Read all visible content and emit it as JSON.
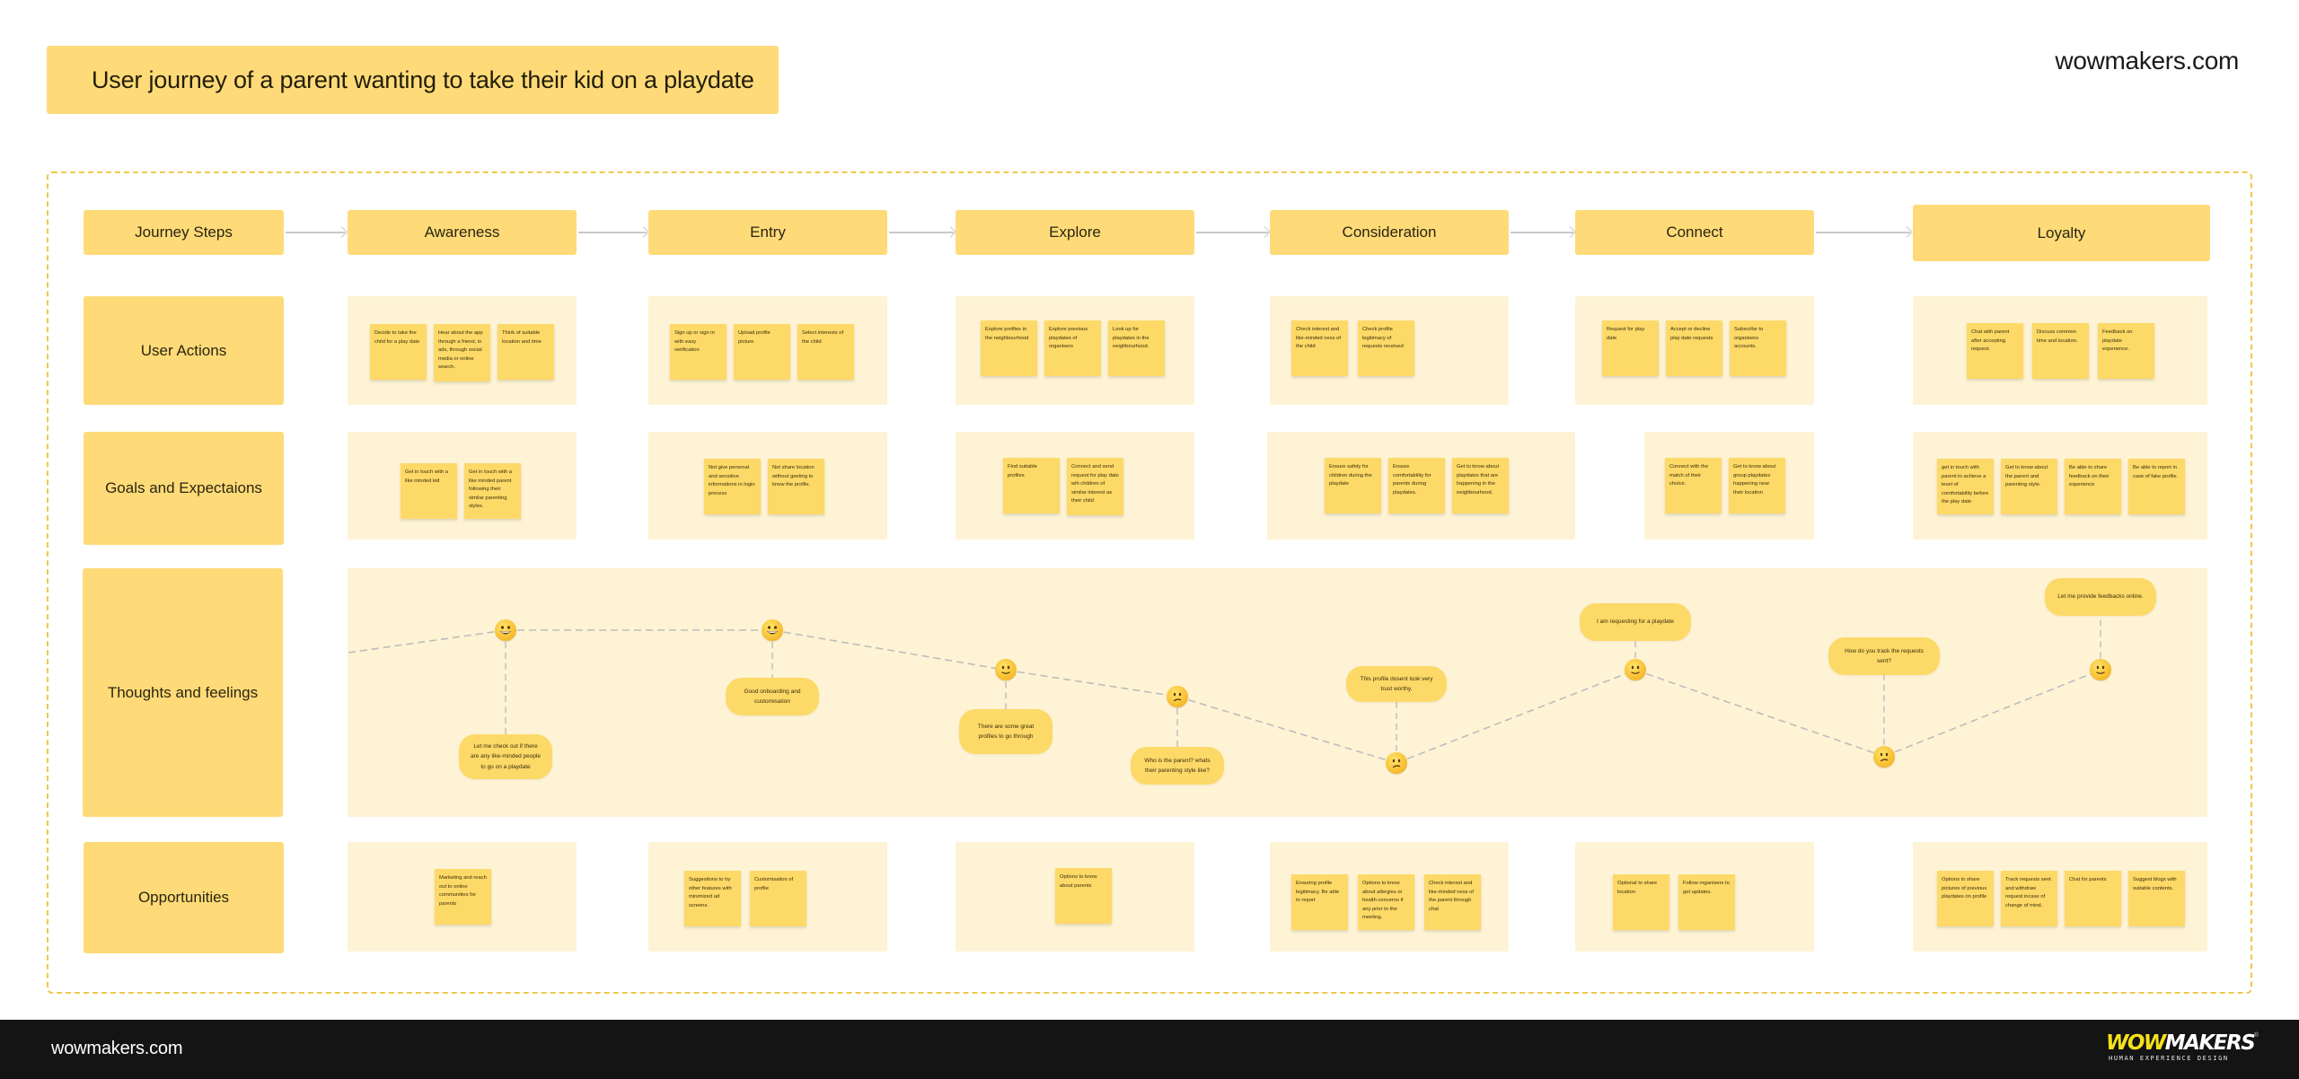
{
  "header": {
    "title": "User journey of a parent wanting to take their kid on a playdate",
    "brand": "wowmakers.com"
  },
  "colors": {
    "label_fill": "#fedb78",
    "panel_fill": "#fef3d4",
    "note_fill": "#fdd968",
    "frame_border": "#f0c84a",
    "footer_bg": "#141414",
    "logo_accent": "#f5e21b"
  },
  "rows": {
    "journey_steps": "Journey Steps",
    "user_actions": "User Actions",
    "goals": "Goals and Expectaions",
    "thoughts": "Thoughts and feelings",
    "opportunities": "Opportunities"
  },
  "stages": [
    {
      "name": "Awareness",
      "actions": [
        "Decide to take the child for a play date",
        "Hear about the app  through a friend, in ads, through social media or online search.",
        "Think of suitable location and time"
      ],
      "goals": [
        "Get in touch with a like minded kid",
        "Get in touch with a like minded parent following their similar parenting styles."
      ],
      "opportunities": [
        "Marketing and reach out to online communities for parents"
      ]
    },
    {
      "name": "Entry",
      "actions": [
        "Sign up or sign in with easy verification",
        "Upload profile picture",
        "Select interests of the child"
      ],
      "goals": [
        "Not give personal and sensitive informations in login process",
        "Not share location without geeting to know the profile."
      ],
      "opportunities": [
        "Suggestions to try other features with minimized ad screens.",
        "Customisation of profile"
      ]
    },
    {
      "name": "Explore",
      "actions": [
        "Explore profiles in the neighbourhood",
        "Explore previous playdates of organisers",
        "Look up for playdates in the neighbourhood."
      ],
      "goals": [
        "Find suitable profiles",
        "Connect and send request for play date wih children of similar interest as their child"
      ],
      "opportunities": [
        "Options to know about parents"
      ]
    },
    {
      "name": "Consideration",
      "actions": [
        "Check interest and like-minded ness of the child",
        "Check profile legitimacy of requests received"
      ],
      "goals": [
        "Ensure safety for children during the playdate",
        "Ensure comfortability for parents during playdates.",
        "Get to know about playdates that are happening in the neighbourhood."
      ],
      "opportunities": [
        "Ensuring profile legitimacy. Be able to report",
        "Options to know about allergies or health concerns if any prior to the meeting.",
        "Check interest and like-minded ness of the parent through chat"
      ]
    },
    {
      "name": "Connect",
      "actions": [
        "Request for play date",
        "Accept or decline play date requests",
        "Subscribe to organisers accounts."
      ],
      "goals": [
        "Connect with the match of their choice.",
        "Get to know about group playdates happening near their location"
      ],
      "opportunities": [
        "Optional to share location",
        "Follow organisers to get updates."
      ]
    },
    {
      "name": "Loyalty",
      "actions": [
        "Chat with parent after accepting request.",
        "Discuss common time and location.",
        "Feedback on playdate experience."
      ],
      "goals": [
        "get in touch with parent to achieve a level of comfortability before the play date",
        "Get to know about the parent and parenting style.",
        "Be able to share feedback on their experience",
        "Be able to report in case of fake profile."
      ],
      "opportunities": [
        "Options to share pictures of previous playdates on profile",
        "Track requests sent and withdraw request incase of change of mind.",
        "Chat for parents",
        "Suggest blogs with suitable contents."
      ]
    }
  ],
  "emotion_curve": {
    "scale": "1 = unhappy, 3 = very happy",
    "points": [
      {
        "stage": "Awareness",
        "mood": "grinning",
        "level": 3,
        "thought": "Let me check out if there are any like-minded people to go on a playdate",
        "bubble_position": "below"
      },
      {
        "stage": "Entry",
        "mood": "grinning",
        "level": 3,
        "thought": "Good onboarding and customisation",
        "bubble_position": "below"
      },
      {
        "stage": "Explore",
        "mood": "slight-smile",
        "level": 2.4,
        "thought": "There are some great profiles to go through",
        "bubble_position": "below"
      },
      {
        "stage": "Explore",
        "mood": "confused",
        "level": 2.0,
        "thought": "Who is the parent? whats their parenting style like?",
        "bubble_position": "below"
      },
      {
        "stage": "Consideration",
        "mood": "confused",
        "level": 1.0,
        "thought": "This profile dosent look very trust worthy.",
        "bubble_position": "above"
      },
      {
        "stage": "Connect",
        "mood": "slight-smile",
        "level": 2.4,
        "thought": "I am requesting for a playdate",
        "bubble_position": "above"
      },
      {
        "stage": "Connect",
        "mood": "confused",
        "level": 1.1,
        "thought": "How do you track the requests sent?",
        "bubble_position": "above"
      },
      {
        "stage": "Loyalty",
        "mood": "slight-smile",
        "level": 2.4,
        "thought": "Let me provide feedbacks online.",
        "bubble_position": "above"
      }
    ]
  },
  "footer": {
    "url": "wowmakers.com",
    "logo_wow": "WOW",
    "logo_makers": "MAKERS",
    "logo_tagline": "HUMAN EXPERIENCE DESIGN",
    "logo_reg": "®"
  }
}
